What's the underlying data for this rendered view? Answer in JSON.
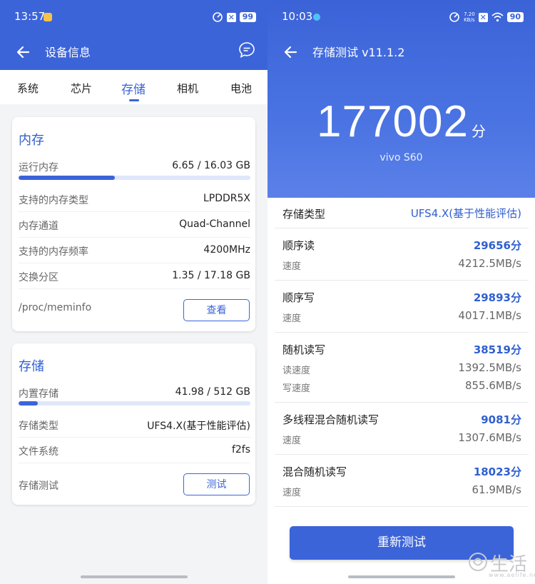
{
  "left": {
    "status": {
      "time": "13:57",
      "battery": "99"
    },
    "header": {
      "title": "设备信息"
    },
    "tabs": [
      "系统",
      "芯片",
      "存储",
      "相机",
      "电池"
    ],
    "active_tab": "存储",
    "memory": {
      "title": "内存",
      "ram_label": "运行内存",
      "ram_value": "6.65 / 16.03 GB",
      "ram_fraction": 0.415,
      "rows": [
        {
          "label": "支持的内存类型",
          "value": "LPDDR5X"
        },
        {
          "label": "内存通道",
          "value": "Quad-Channel"
        },
        {
          "label": "支持的内存频率",
          "value": "4200MHz"
        },
        {
          "label": "交换分区",
          "value": "1.35 / 17.18 GB"
        }
      ],
      "path_label": "/proc/meminfo",
      "view_button": "查看"
    },
    "storage": {
      "title": "存储",
      "internal_label": "内置存储",
      "internal_value": "41.98 / 512 GB",
      "internal_fraction": 0.082,
      "rows": [
        {
          "label": "存储类型",
          "value": "UFS4.X(基于性能评估)"
        },
        {
          "label": "文件系统",
          "value": "f2fs"
        }
      ],
      "test_label": "存储测试",
      "test_button": "测试"
    }
  },
  "right": {
    "status": {
      "time": "10:03",
      "net_speed_top": "7.20",
      "net_speed_bottom": "KB/s",
      "battery": "90"
    },
    "header": {
      "title": "存储测试 v11.1.2"
    },
    "score": "177002",
    "score_unit": "分",
    "device": "vivo S60",
    "storage_type_label": "存储类型",
    "storage_type_value": "UFS4.X(基于性能评估)",
    "tests": [
      {
        "name": "顺序读",
        "points": "29656分",
        "subs": [
          {
            "label": "速度",
            "value": "4212.5MB/s"
          }
        ]
      },
      {
        "name": "顺序写",
        "points": "29893分",
        "subs": [
          {
            "label": "速度",
            "value": "4017.1MB/s"
          }
        ]
      },
      {
        "name": "随机读写",
        "points": "38519分",
        "subs": [
          {
            "label": "读速度",
            "value": "1392.5MB/s"
          },
          {
            "label": "写速度",
            "value": "855.6MB/s"
          }
        ]
      },
      {
        "name": "多线程混合随机读写",
        "points": "9081分",
        "subs": [
          {
            "label": "速度",
            "value": "1307.6MB/s"
          }
        ]
      },
      {
        "name": "混合随机读写",
        "points": "18023分",
        "subs": [
          {
            "label": "速度",
            "value": "61.9MB/s"
          }
        ]
      }
    ],
    "retest_button": "重新测试",
    "watermark": "生活",
    "watermark_small": "www.aelife.net"
  },
  "colors": {
    "accent": "#3c64d9",
    "accent_text": "#2f5fd0",
    "bar_track": "#dfe7fa"
  }
}
